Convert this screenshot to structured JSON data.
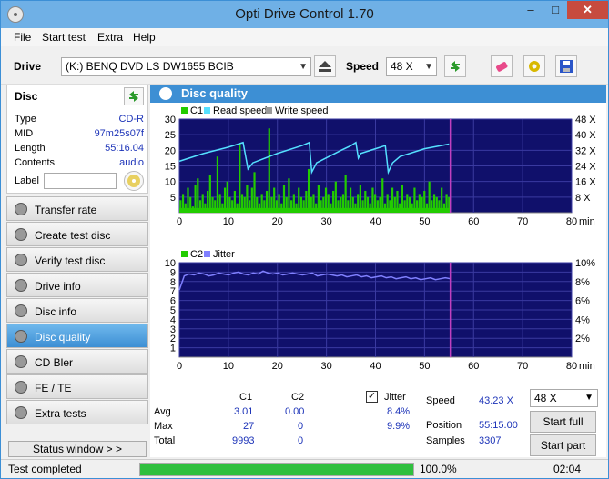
{
  "window": {
    "title": "Opti Drive Control 1.70"
  },
  "menu": [
    "File",
    "Start test",
    "Extra",
    "Help"
  ],
  "toolbar": {
    "drive_label": "Drive",
    "drive_value": "(K:)  BENQ DVD LS DW1655 BCIB",
    "speed_label": "Speed",
    "speed_value": "48 X"
  },
  "disc": {
    "header": "Disc",
    "rows": [
      {
        "k": "Type",
        "v": "CD-R"
      },
      {
        "k": "MID",
        "v": "97m25s07f"
      },
      {
        "k": "Length",
        "v": "55:16.04"
      },
      {
        "k": "Contents",
        "v": "audio"
      }
    ],
    "label_key": "Label"
  },
  "nav": [
    "Transfer rate",
    "Create test disc",
    "Verify test disc",
    "Drive info",
    "Disc info",
    "Disc quality",
    "CD Bler",
    "FE / TE",
    "Extra tests"
  ],
  "nav_active_index": 5,
  "status_window_label": "Status window > >",
  "panel_title": "Disc quality",
  "chart_data": [
    {
      "type": "line",
      "legend": [
        "C1",
        "Read speed",
        "Write speed"
      ],
      "colors": {
        "c1": "#22cc00",
        "read": "#55e0ff",
        "write": "#999999",
        "bg": "#10106b",
        "grid": "#3a3aa0",
        "marker": "#c040c0"
      },
      "x_ticks": [
        0,
        10,
        20,
        30,
        40,
        50,
        60,
        70,
        80
      ],
      "x_unit": "min",
      "y_left_ticks": [
        5,
        10,
        15,
        20,
        25,
        30
      ],
      "y_right_ticks": [
        "8 X",
        "16 X",
        "24 X",
        "32 X",
        "40 X",
        "48 X"
      ],
      "xlim": [
        0,
        80
      ],
      "ylim": [
        0,
        30
      ],
      "data_end": 55.25,
      "c1_samples": [
        4,
        6,
        3,
        8,
        5,
        2,
        9,
        11,
        4,
        6,
        3,
        7,
        12,
        5,
        4,
        18,
        6,
        3,
        8,
        10,
        5,
        4,
        7,
        3,
        22,
        6,
        5,
        9,
        4,
        8,
        13,
        5,
        3,
        6,
        4,
        7,
        27,
        5,
        8,
        4,
        6,
        3,
        9,
        5,
        11,
        4,
        6,
        3,
        8,
        5,
        4,
        7,
        14,
        5,
        6,
        3,
        9,
        4,
        5,
        8,
        6,
        3,
        7,
        10,
        4,
        5,
        6,
        12,
        4,
        8,
        5,
        3,
        6,
        9,
        4,
        7,
        5,
        3,
        8,
        6,
        4,
        5,
        11,
        3,
        6,
        4,
        8,
        5,
        7,
        3,
        9,
        4,
        6,
        5,
        3,
        8,
        4,
        6,
        5,
        7,
        3,
        10,
        4,
        6,
        5,
        4,
        8,
        3,
        6,
        5
      ],
      "read_speed": [
        [
          0,
          16.5
        ],
        [
          5,
          19
        ],
        [
          10,
          21
        ],
        [
          13,
          22.5
        ],
        [
          14,
          14
        ],
        [
          15,
          16
        ],
        [
          20,
          19
        ],
        [
          25,
          21.5
        ],
        [
          26.5,
          22.5
        ],
        [
          27,
          13
        ],
        [
          28,
          16
        ],
        [
          33,
          20
        ],
        [
          35,
          21.5
        ],
        [
          36,
          22.5
        ],
        [
          36.5,
          17.5
        ],
        [
          37,
          19
        ],
        [
          40,
          20.5
        ],
        [
          42,
          21.5
        ],
        [
          42.6,
          13
        ],
        [
          43.5,
          16
        ],
        [
          45,
          18
        ],
        [
          50,
          20.5
        ],
        [
          55,
          22
        ]
      ]
    },
    {
      "type": "line",
      "legend": [
        "C2",
        "Jitter"
      ],
      "colors": {
        "jitter": "#8080ff",
        "bg": "#10106b",
        "grid": "#3a3aa0",
        "marker": "#c040c0"
      },
      "x_ticks": [
        0,
        10,
        20,
        30,
        40,
        50,
        60,
        70,
        80
      ],
      "x_unit": "min",
      "y_left_ticks": [
        1,
        2,
        3,
        4,
        5,
        6,
        7,
        8,
        9,
        10
      ],
      "y_right_ticks": [
        "2%",
        "4%",
        "6%",
        "8%",
        "10%"
      ],
      "xlim": [
        0,
        80
      ],
      "ylim": [
        0,
        10
      ],
      "data_end": 55.25,
      "jitter_samples": [
        7.1,
        8.6,
        8.8,
        8.7,
        8.9,
        8.8,
        8.6,
        8.7,
        8.9,
        8.8,
        8.7,
        8.9,
        9.0,
        8.8,
        8.7,
        8.9,
        8.8,
        9.1,
        8.9,
        8.8,
        8.9,
        8.7,
        8.8,
        8.9,
        8.8,
        8.7,
        8.8,
        8.9,
        8.6,
        8.7,
        8.8,
        8.7,
        8.6,
        8.7,
        8.5,
        8.6,
        8.7,
        8.5,
        8.6,
        8.4,
        8.5,
        8.6,
        8.4,
        8.5,
        8.3,
        8.4,
        8.5,
        8.3,
        8.4,
        8.2,
        8.3,
        8.4,
        8.2,
        8.3,
        8.4,
        8.3
      ]
    }
  ],
  "stats": {
    "headers": [
      "C1",
      "C2"
    ],
    "rows": [
      {
        "k": "Avg",
        "c1": "3.01",
        "c2": "0.00",
        "jitter": "8.4%"
      },
      {
        "k": "Max",
        "c1": "27",
        "c2": "0",
        "jitter": "9.9%"
      },
      {
        "k": "Total",
        "c1": "9993",
        "c2": "0",
        "jitter": ""
      }
    ],
    "jitter_label": "Jitter",
    "speed_label": "Speed",
    "speed_value": "43.23 X",
    "speed_select": "48 X",
    "position_label": "Position",
    "position_value": "55:15.00",
    "samples_label": "Samples",
    "samples_value": "3307",
    "start_full": "Start full",
    "start_part": "Start part"
  },
  "status": {
    "text": "Test completed",
    "percent": "100.0%",
    "progress": 1.0,
    "time": "02:04"
  }
}
